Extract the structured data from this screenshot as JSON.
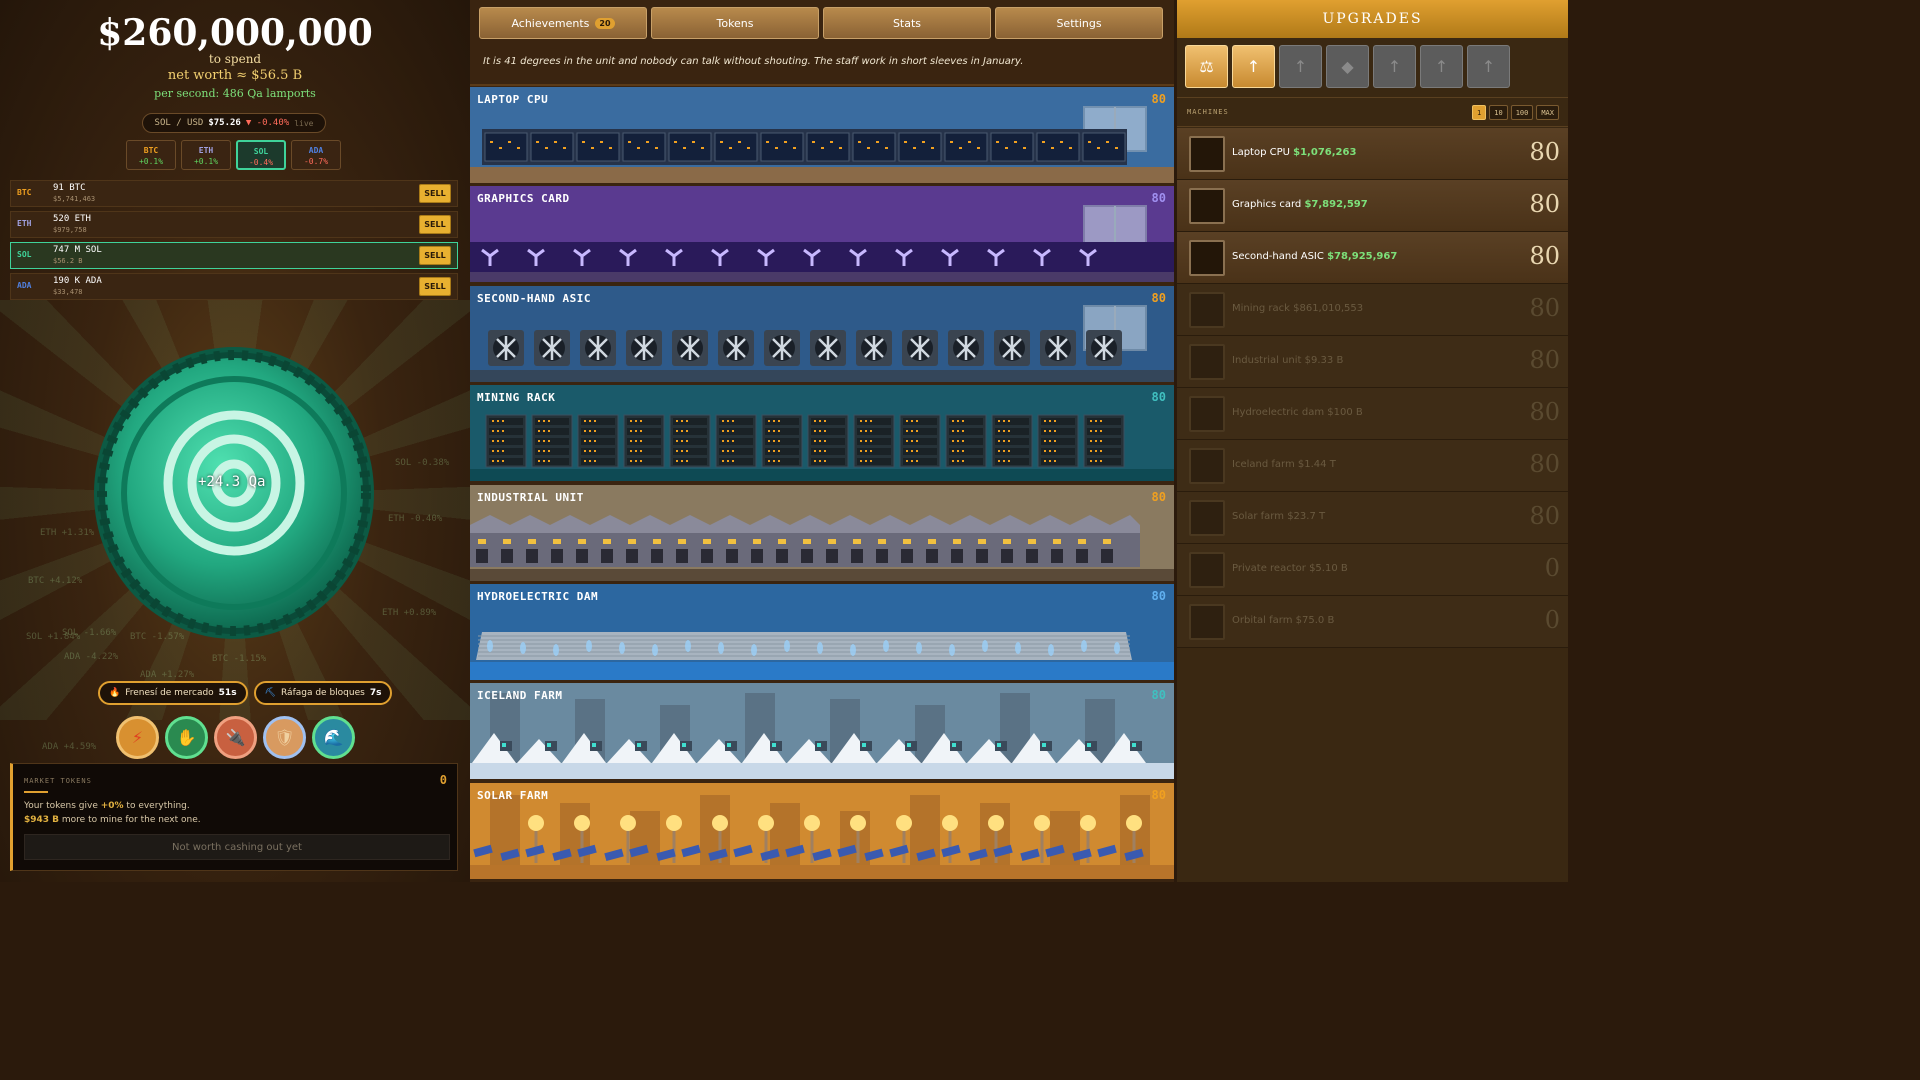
{
  "wallet": {
    "amount": "$260,000,000",
    "to_spend": "to spend",
    "net_worth": "net worth ≈ $56.5 B",
    "per_second": "per second: 486 Qa lamports"
  },
  "ticker": {
    "pair": "SOL / USD",
    "price": "$75.26",
    "change": "▼ -0.40%",
    "live": "live"
  },
  "coins": [
    {
      "sym": "BTC",
      "chg": "+0.1%",
      "color": "#f0a020"
    },
    {
      "sym": "ETH",
      "chg": "+0.1%",
      "color": "#a0a0e0"
    },
    {
      "sym": "SOL",
      "chg": "-0.4%",
      "color": "#3fd39a"
    },
    {
      "sym": "ADA",
      "chg": "-0.7%",
      "color": "#5080e0"
    }
  ],
  "holdings": [
    {
      "sym": "BTC",
      "amount": "91 BTC",
      "value": "$5,741,463",
      "sell": "SELL"
    },
    {
      "sym": "ETH",
      "amount": "520 ETH",
      "value": "$979,758",
      "sell": "SELL"
    },
    {
      "sym": "SOL",
      "amount": "747 M SOL",
      "value": "$56.2 B",
      "sell": "SELL"
    },
    {
      "sym": "ADA",
      "amount": "190 K ADA",
      "value": "$33,478",
      "sell": "SELL"
    }
  ],
  "coin_gain": "+24.3 Qa",
  "floating_texts": [
    "SOL -0.38%",
    "ETH +1.31%",
    "BTC +4.12%",
    "SOL -1.66%",
    "ETH +0.89%",
    "ADA -4.22%",
    "BTC -1.15%",
    "ADA +1.27%",
    "ETH -0.40%",
    "SOL +1.84%",
    "BTC -1.57%",
    "ADA +4.59%"
  ],
  "boosts": [
    {
      "name": "Frenesí de mercado",
      "time": "51s",
      "icon": "🔥"
    },
    {
      "name": "Ráfaga de bloques",
      "time": "7s",
      "icon": "⛏"
    }
  ],
  "powers": [
    {
      "icon": "⚡",
      "name": "lightning"
    },
    {
      "icon": "✋",
      "name": "hand"
    },
    {
      "icon": "🔌",
      "name": "plug"
    },
    {
      "icon": "🛡",
      "name": "shield"
    },
    {
      "icon": "🌊",
      "name": "wave"
    }
  ],
  "market_tokens": {
    "title": "MARKET TOKENS",
    "count": "0",
    "line1_pre": "Your tokens give ",
    "line1_hl": "+0%",
    "line1_post": " to everything.",
    "line2_hl": "$943 B",
    "line2_post": " more to mine for the next one.",
    "cash_label": "Not worth cashing out yet"
  },
  "tabs": [
    {
      "label": "Achievements",
      "badge": "20"
    },
    {
      "label": "Tokens",
      "badge": ""
    },
    {
      "label": "Stats",
      "badge": ""
    },
    {
      "label": "Settings",
      "badge": ""
    }
  ],
  "flavor_text": "It is 41 degrees in the unit and nobody can talk without shouting. The staff work in short sleeves in January.",
  "machine_rows": [
    {
      "name": "LAPTOP CPU",
      "level": "80",
      "color": "#f0a020",
      "bg": "#3a6ca0"
    },
    {
      "name": "GRAPHICS CARD",
      "level": "80",
      "color": "#a090f0",
      "bg": "#5a3a90"
    },
    {
      "name": "SECOND-HAND ASIC",
      "level": "80",
      "color": "#f0a020",
      "bg": "#2e5a8a"
    },
    {
      "name": "MINING RACK",
      "level": "80",
      "color": "#40c0c0",
      "bg": "#1a5a6a"
    },
    {
      "name": "INDUSTRIAL UNIT",
      "level": "80",
      "color": "#f0a020",
      "bg": "#8a7a60"
    },
    {
      "name": "HYDROELECTRIC DAM",
      "level": "80",
      "color": "#60b0f0",
      "bg": "#2e6aa0"
    },
    {
      "name": "ICELAND FARM",
      "level": "80",
      "color": "#40c0c0",
      "bg": "#6a8aa0"
    },
    {
      "name": "SOLAR FARM",
      "level": "80",
      "color": "#f0a020",
      "bg": "#d08a30"
    }
  ],
  "upgrades": {
    "title": "UPGRADES",
    "icons": [
      "scales-icon",
      "arrow-up-icon",
      "arrow-up-icon",
      "chip-icon",
      "arrow-up-icon",
      "arrow-up-icon",
      "arrow-up-icon"
    ],
    "machines_label": "MACHINES",
    "qty": [
      "1",
      "10",
      "100",
      "MAX"
    ]
  },
  "machines": [
    {
      "name": "Laptop CPU",
      "price": "$1,076,263",
      "count": "80",
      "enabled": true
    },
    {
      "name": "Graphics card",
      "price": "$7,892,597",
      "count": "80",
      "enabled": true
    },
    {
      "name": "Second-hand ASIC",
      "price": "$78,925,967",
      "count": "80",
      "enabled": true
    },
    {
      "name": "Mining rack",
      "price": "$861,010,553",
      "count": "80",
      "enabled": false
    },
    {
      "name": "Industrial unit",
      "price": "$9.33 B",
      "count": "80",
      "enabled": false
    },
    {
      "name": "Hydroelectric dam",
      "price": "$100 B",
      "count": "80",
      "enabled": false
    },
    {
      "name": "Iceland farm",
      "price": "$1.44 T",
      "count": "80",
      "enabled": false
    },
    {
      "name": "Solar farm",
      "price": "$23.7 T",
      "count": "80",
      "enabled": false
    },
    {
      "name": "Private reactor",
      "price": "$5.10 B",
      "count": "0",
      "enabled": false
    },
    {
      "name": "Orbital farm",
      "price": "$75.0 B",
      "count": "0",
      "enabled": false
    }
  ]
}
